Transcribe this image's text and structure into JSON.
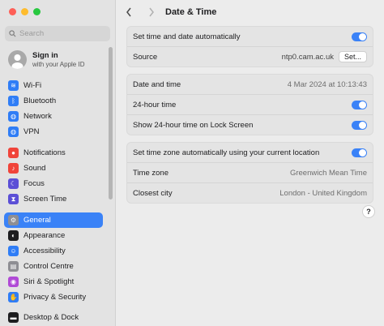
{
  "window": {
    "title": "Date & Time"
  },
  "search": {
    "placeholder": "Search"
  },
  "account": {
    "title": "Sign in",
    "subtitle": "with your Apple ID"
  },
  "sidebar": {
    "group1": [
      {
        "label": "Wi-Fi",
        "icon": "wifi-icon",
        "color": "#2f7df6"
      },
      {
        "label": "Bluetooth",
        "icon": "bluetooth-icon",
        "color": "#2f7df6"
      },
      {
        "label": "Network",
        "icon": "network-icon",
        "color": "#2f7df6"
      },
      {
        "label": "VPN",
        "icon": "vpn-icon",
        "color": "#2f7df6"
      }
    ],
    "group2": [
      {
        "label": "Notifications",
        "icon": "notifications-icon",
        "color": "#f0443a"
      },
      {
        "label": "Sound",
        "icon": "sound-icon",
        "color": "#f0443a"
      },
      {
        "label": "Focus",
        "icon": "focus-icon",
        "color": "#5b4fd6"
      },
      {
        "label": "Screen Time",
        "icon": "screen-time-icon",
        "color": "#5b4fd6"
      }
    ],
    "group3": [
      {
        "label": "General",
        "icon": "general-icon",
        "color": "#8e8e93",
        "selected": true
      },
      {
        "label": "Appearance",
        "icon": "appearance-icon",
        "color": "#1d1d1f"
      },
      {
        "label": "Accessibility",
        "icon": "accessibility-icon",
        "color": "#2f7df6"
      },
      {
        "label": "Control Centre",
        "icon": "control-centre-icon",
        "color": "#8e8e93"
      },
      {
        "label": "Siri & Spotlight",
        "icon": "siri-icon",
        "color": "#b04ad6"
      },
      {
        "label": "Privacy & Security",
        "icon": "privacy-icon",
        "color": "#2f7df6"
      }
    ],
    "group4": [
      {
        "label": "Desktop & Dock",
        "icon": "desktop-dock-icon",
        "color": "#1d1d1f"
      }
    ]
  },
  "settings": {
    "auto_time": {
      "label": "Set time and date automatically",
      "enabled": true
    },
    "source": {
      "label": "Source",
      "value": "ntp0.cam.ac.uk",
      "button": "Set..."
    },
    "date_time": {
      "label": "Date and time",
      "value": "4 Mar 2024 at 10:13:43"
    },
    "h24": {
      "label": "24-hour time",
      "enabled": true
    },
    "h24_lock": {
      "label": "Show 24-hour time on Lock Screen",
      "enabled": true
    },
    "auto_tz": {
      "label": "Set time zone automatically using your current location",
      "enabled": true
    },
    "time_zone": {
      "label": "Time zone",
      "value": "Greenwich Mean Time"
    },
    "closest_city": {
      "label": "Closest city",
      "value": "London - United Kingdom"
    }
  },
  "help": {
    "label": "?"
  },
  "colors": {
    "accent": "#3a82f7"
  }
}
